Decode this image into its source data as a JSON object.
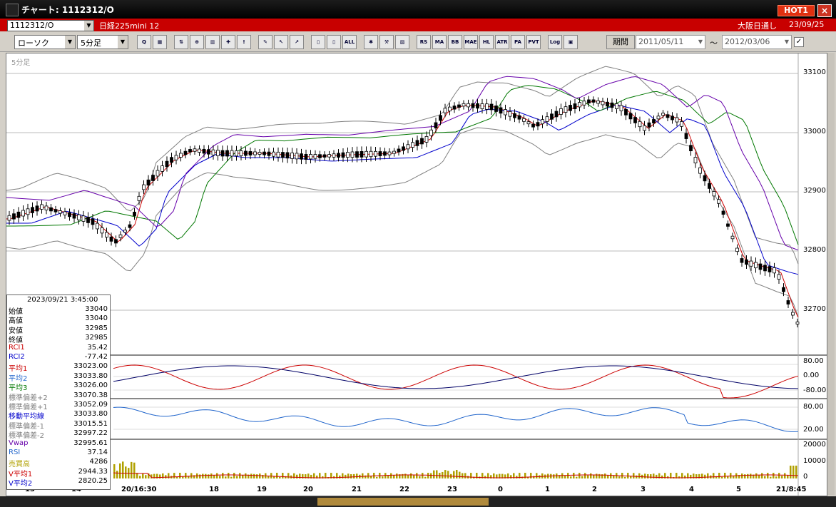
{
  "window": {
    "title": "チャート: 1112312/O",
    "hot_badge": "HOT1",
    "close": "×"
  },
  "header": {
    "symbol_code": "1112312/O",
    "symbol_name": "日経225mini 12",
    "session": "大阪日通し",
    "session_date": "23/09/25"
  },
  "toolbar": {
    "chart_type": "ローソク",
    "timeframe": "5分足",
    "icons": [
      "search",
      "grid",
      "buy-sell",
      "zoom",
      "bars",
      "cross",
      "warn",
      "pencil",
      "cursor",
      "link",
      "candle-a",
      "candle-b",
      "ALL",
      "gear",
      "wrench",
      "palette",
      "RS",
      "MA",
      "BB",
      "MAE",
      "HL",
      "ATR",
      "PA",
      "PVT",
      "Log",
      "print"
    ],
    "icon_labels": [
      "Q",
      "▦",
      "⇅",
      "⊕",
      "▥",
      "✚",
      "!",
      "✎",
      "↖",
      "↗",
      "▯",
      "▯",
      "ALL",
      "✱",
      "⚒",
      "▨",
      "RS",
      "MA",
      "BB",
      "MAE",
      "HL",
      "ATR",
      "PA",
      "PVT",
      "Log",
      "▣"
    ],
    "period_label": "期間",
    "date_from": "2011/05/11",
    "date_to": "2012/03/06",
    "tilde": "～"
  },
  "chart": {
    "timeframe_label": "5分足",
    "price_axis": [
      "33100",
      "33000",
      "32900",
      "32800",
      "32700"
    ],
    "rci_axis": [
      "80.00",
      "0.00",
      "-80.00"
    ],
    "rsi_axis": [
      "80.00",
      "20.00"
    ],
    "volume_axis": [
      "20000",
      "10000",
      "0"
    ],
    "x_axis": [
      "13",
      "14",
      "20/16:30",
      "18",
      "19",
      "20",
      "21",
      "22",
      "23",
      "0",
      "1",
      "2",
      "3",
      "4",
      "5",
      "21/8:45"
    ],
    "colors": {
      "ma1": "#cc0000",
      "ma2": "#0000cc",
      "ma3": "#007700",
      "vwap": "#6600aa",
      "band": "#808080",
      "rsi": "#2266cc",
      "volume": "#b0a000"
    }
  },
  "info_panel": {
    "datetime": "2023/09/21 3:45:00",
    "rows": [
      {
        "label": "始値",
        "value": "33040",
        "color": "#000000"
      },
      {
        "label": "高値",
        "value": "33040",
        "color": "#000000"
      },
      {
        "label": "安値",
        "value": "32985",
        "color": "#000000"
      },
      {
        "label": "終値",
        "value": "32985",
        "color": "#000000"
      },
      {
        "label": "RCI1",
        "value": "35.42",
        "color": "#cc0000"
      },
      {
        "label": "RCI2",
        "value": "-77.42",
        "color": "#0000cc"
      },
      {
        "label": "平均1",
        "value": "33023.00",
        "color": "#cc0000"
      },
      {
        "label": "平均2",
        "value": "33033.80",
        "color": "#2266cc"
      },
      {
        "label": "平均3",
        "value": "33026.00",
        "color": "#007700"
      },
      {
        "label": "標準偏差+2",
        "value": "33070.38",
        "color": "#808080"
      },
      {
        "label": "標準偏差+1",
        "value": "33052.09",
        "color": "#808080"
      },
      {
        "label": "移動平均線",
        "value": "33033.80",
        "color": "#0000cc"
      },
      {
        "label": "標準偏差-1",
        "value": "33015.51",
        "color": "#808080"
      },
      {
        "label": "標準偏差-2",
        "value": "32997.22",
        "color": "#808080"
      },
      {
        "label": "Vwap",
        "value": "32995.61",
        "color": "#6600aa"
      },
      {
        "label": "RSI",
        "value": "37.14",
        "color": "#2266cc"
      },
      {
        "label": "売買高",
        "value": "4286",
        "color": "#b0a000"
      },
      {
        "label": "V平均1",
        "value": "2944.33",
        "color": "#cc0000"
      },
      {
        "label": "V平均2",
        "value": "2820.25",
        "color": "#0000cc"
      }
    ]
  }
}
